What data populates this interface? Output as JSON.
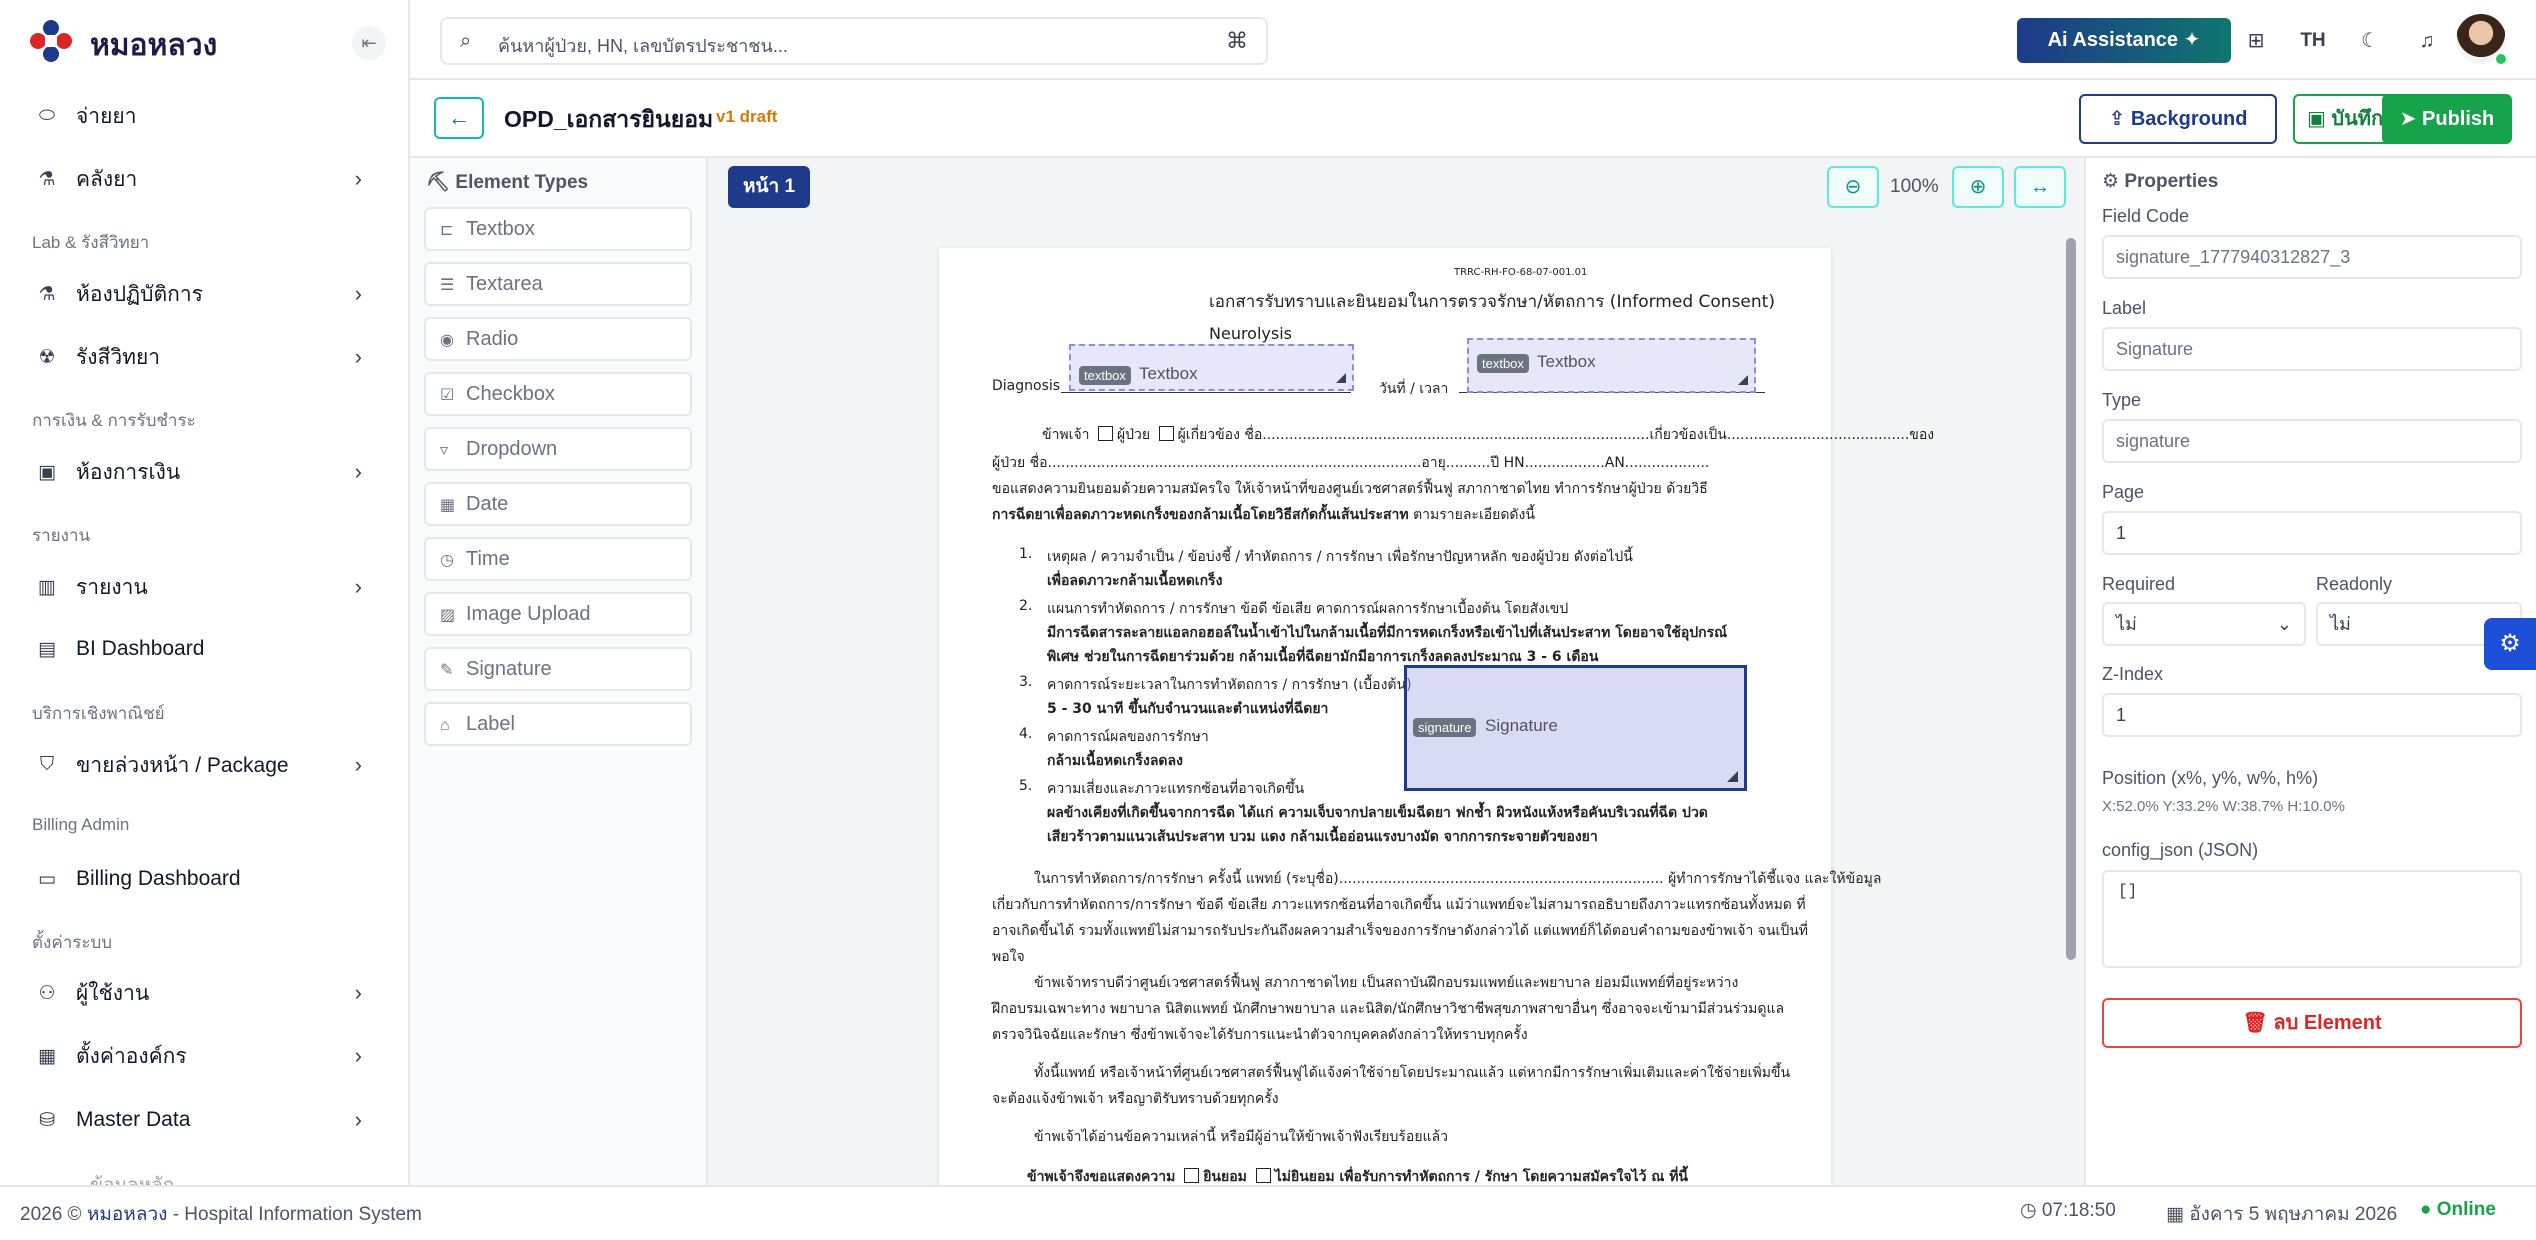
{
  "app": {
    "name": "หมอหลวง"
  },
  "sidebar": {
    "items": [
      {
        "label": "จ่ายยา",
        "icon": "pill-icon",
        "chevron": false
      },
      {
        "label": "คลังยา",
        "icon": "flask-icon",
        "chevron": true
      },
      {
        "section": "Lab & รังสีวิทยา"
      },
      {
        "label": "ห้องปฏิบัติการ",
        "icon": "flask-icon",
        "chevron": true
      },
      {
        "label": "รังสีวิทยา",
        "icon": "radiation-icon",
        "chevron": true
      },
      {
        "section": "การเงิน & การรับชำระ"
      },
      {
        "label": "ห้องการเงิน",
        "icon": "money-icon",
        "chevron": true
      },
      {
        "section": "รายงาน"
      },
      {
        "label": "รายงาน",
        "icon": "chart-icon",
        "chevron": true
      },
      {
        "label": "BI Dashboard",
        "icon": "dashboard-icon",
        "chevron": false
      },
      {
        "section": "บริการเชิงพาณิชย์"
      },
      {
        "label": "ขายล่วงหน้า / Package",
        "icon": "bag-icon",
        "chevron": true
      },
      {
        "section": "Billing Admin"
      },
      {
        "label": "Billing Dashboard",
        "icon": "card-icon",
        "chevron": false
      },
      {
        "section": "ตั้งค่าระบบ"
      },
      {
        "label": "ผู้ใช้งาน",
        "icon": "users-icon",
        "chevron": true
      },
      {
        "label": "ตั้งค่าองค์กร",
        "icon": "building-icon",
        "chevron": true
      },
      {
        "label": "Master Data",
        "icon": "database-icon",
        "chevron": true
      },
      {
        "label": "ข้อมูลหลัก",
        "sub": true
      }
    ]
  },
  "topbar": {
    "search_placeholder": "ค้นหาผู้ป่วย, HN, เลขบัตรประชาชน...",
    "ai_button": "Ai Assistance",
    "lang": "TH"
  },
  "editor": {
    "title": "OPD_เอกสารยินยอม",
    "version": "v1 draft",
    "background_button": "Background",
    "save_button": "บันทึก",
    "publish_button": "Publish"
  },
  "palette": {
    "title": "Element Types",
    "items": [
      {
        "label": "Textbox",
        "icon": "textbox-icon"
      },
      {
        "label": "Textarea",
        "icon": "textarea-icon"
      },
      {
        "label": "Radio",
        "icon": "radio-icon"
      },
      {
        "label": "Checkbox",
        "icon": "checkbox-icon"
      },
      {
        "label": "Dropdown",
        "icon": "dropdown-icon"
      },
      {
        "label": "Date",
        "icon": "calendar-icon"
      },
      {
        "label": "Time",
        "icon": "clock-icon"
      },
      {
        "label": "Image Upload",
        "icon": "image-icon"
      },
      {
        "label": "Signature",
        "icon": "pen-icon"
      },
      {
        "label": "Label",
        "icon": "tag-icon"
      }
    ]
  },
  "canvas": {
    "page_tab": "หน้า 1",
    "zoom": "100%"
  },
  "document": {
    "code": "TRRC-RH-FO-68-07-001.01",
    "heading": "เอกสารรับทราบและยินยอมในการตรวจรักษา/หัตถการ (Informed Consent)",
    "subject": "Neurolysis",
    "diagnosis_label": "Diagnosis",
    "date_label": "วันที่ / เวลา",
    "line1": "ข้าพเจ้า",
    "line1_patient": "ผู้ป่วย",
    "line1_rel": "ผู้เกี่ยวข้อง ชื่อ.......................................................................................เกี่ยวข้องเป็น.........................................ของ",
    "line2": "ผู้ป่วย ชื่อ....................................................................................อายุ..........ปี HN..................AN...................",
    "line3": "ขอแสดงความยินยอมด้วยความสมัครใจ ให้เจ้าหน้าที่ของศูนย์เวชศาสตร์ฟื้นฟู สภากาชาดไทย ทำการรักษาผู้ป่วย ด้วยวิธี",
    "line4_bold": "การฉีดยาเพื่อลดภาวะหดเกร็งของกล้ามเนื้อโดยวิธีสกัดกั้นเส้นประสาท",
    "line4_rest": " ตามรายละเอียดดังนี้",
    "items": [
      {
        "num": "1.",
        "text": "เหตุผล / ความจำเป็น / ข้อบ่งชี้ / ทำหัตถการ / การรักษา เพื่อรักษาปัญหาหลัก ของผู้ป่วย ดังต่อไปนี้",
        "bold": [
          "เพื่อลดภาวะกล้ามเนื้อหดเกร็ง"
        ]
      },
      {
        "num": "2.",
        "text": "แผนการทำหัตถการ / การรักษา ข้อดี ข้อเสีย คาดการณ์ผลการรักษาเบื้องต้น โดยสังเขป",
        "bold": [
          "มีการฉีดสารละลายแอลกอฮอล์ในน้ำเข้าไปในกล้ามเนื้อที่มีการหดเกร็งหรือเข้าไปที่เส้นประสาท โดยอาจใช้อุปกรณ์",
          "พิเศษ ช่วยในการฉีดยาร่วมด้วย กล้ามเนื้อที่ฉีดยามักมีอาการเกร็งลดลงประมาณ 3 - 6 เดือน"
        ]
      },
      {
        "num": "3.",
        "text": "คาดการณ์ระยะเวลาในการทำหัตถการ / การรักษา (เบื้องต้น)",
        "bold": [
          "5 - 30 นาที ขึ้นกับจำนวนและตำแหน่งที่ฉีดยา"
        ]
      },
      {
        "num": "4.",
        "text": "คาดการณ์ผลของการรักษา",
        "bold": [
          "กล้ามเนื้อหดเกร็งลดลง"
        ]
      },
      {
        "num": "5.",
        "text": "ความเสี่ยงและภาวะแทรกซ้อนที่อาจเกิดขึ้น",
        "bold": [
          "ผลข้างเคียงที่เกิดขึ้นจากการฉีด ได้แก่ ความเจ็บจากปลายเข็มฉีดยา ฟกช้ำ ผิวหนังแห้งหรือคันบริเวณที่ฉีด ปวด",
          "เสียวร้าวตามแนวเส้นประสาท บวม แดง กล้ามเนื้ออ่อนแรงบางมัด จากการกระจายตัวของยา"
        ]
      }
    ],
    "para1": [
      "ในการทำหัตถการ/การรักษา ครั้งนี้ แพทย์ (ระบุชื่อ)......................................................................... ผู้ทำการรักษาได้ชี้แจง และให้ข้อมูล",
      "เกี่ยวกับการทำหัตถการ/การรักษา ข้อดี ข้อเสีย ภาวะแทรกซ้อนที่อาจเกิดขึ้น แม้ว่าแพทย์จะไม่สามารถอธิบายถึงภาวะแทรกซ้อนทั้งหมด ที่",
      "อาจเกิดขึ้นได้ รวมทั้งแพทย์ไม่สามารถรับประกันถึงผลความสำเร็จของการรักษาดังกล่าวได้ แต่แพทย์ก็ได้ตอบคำถามของข้าพเจ้า จนเป็นที่",
      "พอใจ"
    ],
    "para2": [
      "ข้าพเจ้าทราบดีว่าศูนย์เวชศาสตร์ฟื้นฟู สภากาชาดไทย เป็นสถาบันฝึกอบรมแพทย์และพยาบาล ย่อมมีแพทย์ที่อยู่ระหว่าง",
      "ฝึกอบรมเฉพาะทาง พยาบาล นิสิตแพทย์ นักศึกษาพยาบาล และนิสิต/นักศึกษาวิชาชีพสุขภาพสาขาอื่นๆ ซึ่งอาจจะเข้ามามีส่วนร่วมดูแล",
      "ตรวจวินิจฉัยและรักษา ซึ่งข้าพเจ้าจะได้รับการแนะนำตัวจากบุคคลดังกล่าวให้ทราบทุกครั้ง"
    ],
    "para3": [
      "ทั้งนี้แพทย์ หรือเจ้าหน้าที่ศูนย์เวชศาสตร์ฟื้นฟูได้แจ้งค่าใช้จ่ายโดยประมาณแล้ว แต่หากมีการรักษาเพิ่มเติมและค่าใช้จ่ายเพิ่มขึ้น",
      "จะต้องแจ้งข้าพเจ้า หรือญาติรับทราบด้วยทุกครั้ง"
    ],
    "para4": "ข้าพเจ้าได้อ่านข้อความเหล่านี้ หรือมีผู้อ่านให้ข้าพเจ้าฟังเรียบร้อยแล้ว",
    "final_prefix": "ข้าพเจ้าจึงขอแสดงความ",
    "final_agree": "ยินยอม",
    "final_rest": "ไม่ยินยอม  เพื่อรับการทำหัตถการ / รักษา  โดยความสมัครใจไว้ ณ ที่นี้"
  },
  "fields": {
    "diag": {
      "tag": "textbox",
      "text": "Textbox"
    },
    "date": {
      "tag": "textbox",
      "text": "Textbox"
    },
    "sig": {
      "tag": "signature",
      "text": "Signature"
    }
  },
  "properties": {
    "title": "Properties",
    "field_code_label": "Field Code",
    "field_code": "signature_1777940312827_3",
    "label_label": "Label",
    "label": "Signature",
    "type_label": "Type",
    "type": "signature",
    "page_label": "Page",
    "page": "1",
    "required_label": "Required",
    "required": "ไม่",
    "readonly_label": "Readonly",
    "readonly": "ไม่",
    "zindex_label": "Z-Index",
    "zindex": "1",
    "position_label": "Position (x%, y%, w%, h%)",
    "position": "X:52.0% Y:33.2% W:38.7% H:10.0%",
    "config_label": "config_json (JSON)",
    "config": "[]",
    "delete_button": "ลบ Element"
  },
  "footer": {
    "year": "2026 ©",
    "brand": "หมอหลวง",
    "suffix": "- Hospital Information System",
    "time": "07:18:50",
    "date": "อังคาร 5 พฤษภาคม 2026",
    "status": "Online"
  },
  "colors": {
    "primary": "#1e3a8a",
    "accent": "#16a34a",
    "teal": "#14b8a6",
    "danger": "#dc2626",
    "draft": "#d97706"
  }
}
